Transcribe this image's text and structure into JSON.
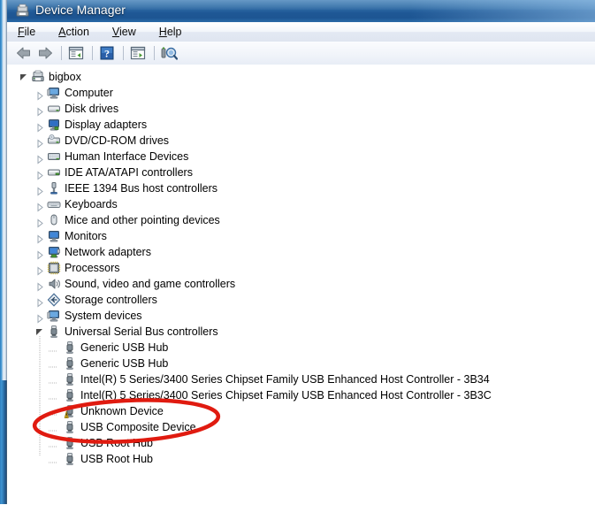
{
  "window": {
    "title": "Device Manager",
    "title_icon": "device-manager-icon"
  },
  "menu": {
    "items": [
      {
        "label": "File",
        "accel": "F"
      },
      {
        "label": "Action",
        "accel": "A"
      },
      {
        "label": "View",
        "accel": "V"
      },
      {
        "label": "Help",
        "accel": "H"
      }
    ]
  },
  "toolbar": {
    "buttons": [
      {
        "name": "back-button",
        "icon": "back-arrow-icon",
        "label": "Back"
      },
      {
        "name": "forward-button",
        "icon": "forward-arrow-icon",
        "label": "Forward"
      },
      {
        "name": "show-hide-console-tree-button",
        "icon": "console-tree-icon",
        "label": "Show/Hide Console Tree"
      },
      {
        "name": "help-button",
        "icon": "help-question-icon",
        "label": "Help"
      },
      {
        "name": "properties-button",
        "icon": "properties-icon",
        "label": "Properties"
      },
      {
        "name": "scan-for-hardware-changes-button",
        "icon": "scan-hardware-icon",
        "label": "Scan for hardware changes"
      }
    ]
  },
  "tree": {
    "root": {
      "label": "bigbox",
      "icon": "computer-node-icon",
      "state": "expanded"
    },
    "nodes": [
      {
        "label": "Computer",
        "icon": "computer-icon",
        "state": "collapsed",
        "level": 1
      },
      {
        "label": "Disk drives",
        "icon": "disk-drive-icon",
        "state": "collapsed",
        "level": 1
      },
      {
        "label": "Display adapters",
        "icon": "display-adapter-icon",
        "state": "collapsed",
        "level": 1
      },
      {
        "label": "DVD/CD-ROM drives",
        "icon": "dvd-drive-icon",
        "state": "collapsed",
        "level": 1
      },
      {
        "label": "Human Interface Devices",
        "icon": "hid-icon",
        "state": "collapsed",
        "level": 1
      },
      {
        "label": "IDE ATA/ATAPI controllers",
        "icon": "ide-controller-icon",
        "state": "collapsed",
        "level": 1
      },
      {
        "label": "IEEE 1394 Bus host controllers",
        "icon": "ieee1394-icon",
        "state": "collapsed",
        "level": 1
      },
      {
        "label": "Keyboards",
        "icon": "keyboard-icon",
        "state": "collapsed",
        "level": 1
      },
      {
        "label": "Mice and other pointing devices",
        "icon": "mouse-icon",
        "state": "collapsed",
        "level": 1
      },
      {
        "label": "Monitors",
        "icon": "monitor-icon",
        "state": "collapsed",
        "level": 1
      },
      {
        "label": "Network adapters",
        "icon": "network-adapter-icon",
        "state": "collapsed",
        "level": 1
      },
      {
        "label": "Processors",
        "icon": "processor-icon",
        "state": "collapsed",
        "level": 1
      },
      {
        "label": "Sound, video and game controllers",
        "icon": "sound-icon",
        "state": "collapsed",
        "level": 1
      },
      {
        "label": "Storage controllers",
        "icon": "storage-controller-icon",
        "state": "collapsed",
        "level": 1
      },
      {
        "label": "System devices",
        "icon": "system-device-icon",
        "state": "collapsed",
        "level": 1
      },
      {
        "label": "Universal Serial Bus controllers",
        "icon": "usb-icon",
        "state": "expanded",
        "level": 1
      },
      {
        "label": "Generic USB Hub",
        "icon": "usb-device-icon",
        "state": "leaf",
        "level": 2
      },
      {
        "label": "Generic USB Hub",
        "icon": "usb-device-icon",
        "state": "leaf",
        "level": 2
      },
      {
        "label": "Intel(R) 5 Series/3400 Series Chipset Family USB Enhanced Host Controller - 3B34",
        "icon": "usb-device-icon",
        "state": "leaf",
        "level": 2
      },
      {
        "label": "Intel(R) 5 Series/3400 Series Chipset Family USB Enhanced Host Controller - 3B3C",
        "icon": "usb-device-icon",
        "state": "leaf",
        "level": 2
      },
      {
        "label": "Unknown Device",
        "icon": "usb-device-warning-icon",
        "state": "leaf",
        "level": 2,
        "warning": true
      },
      {
        "label": "USB Composite Device",
        "icon": "usb-device-icon",
        "state": "leaf",
        "level": 2
      },
      {
        "label": "USB Root Hub",
        "icon": "usb-device-icon",
        "state": "leaf",
        "level": 2
      },
      {
        "label": "USB Root Hub",
        "icon": "usb-device-icon",
        "state": "leaf",
        "level": 2
      }
    ]
  },
  "annotation": {
    "shape": "ellipse",
    "color": "#e01b10",
    "targets": [
      "Unknown Device",
      "USB Composite Device"
    ]
  },
  "colors": {
    "titlebar": "#1f5896",
    "annotation_red": "#e01b10",
    "warning_yellow": "#f5c518",
    "text": "#000000"
  }
}
